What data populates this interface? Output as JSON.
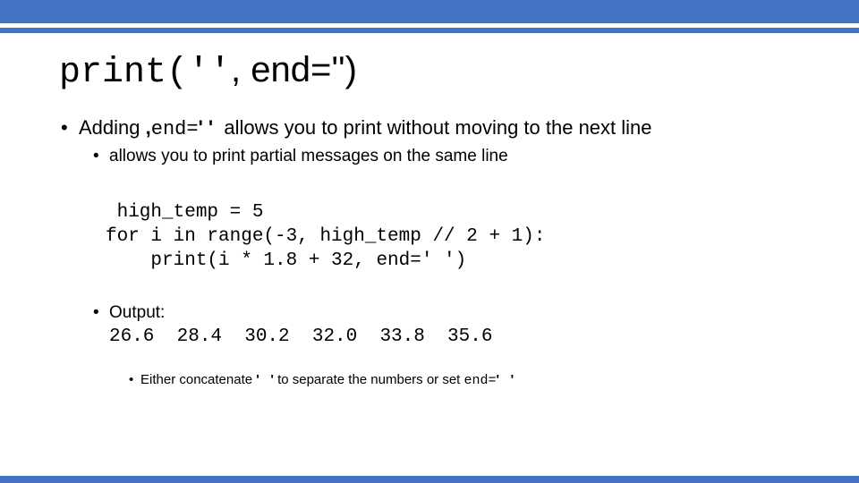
{
  "theme": {
    "accent_color": "#4472C4",
    "background_color": "#FFFFFF",
    "text_color": "#000000"
  },
  "title": {
    "part_mono_open": "print('",
    "part_mono_close": "'",
    "part_sans_tail": ", end='')"
  },
  "bullets": {
    "b1_dot": "•",
    "b1_text_a": "Adding ",
    "b1_code_comma": ",",
    "b1_code_end": "end=",
    "b1_code_quotes": "' '",
    "b1_text_b": "  allows you to print without moving to the next line",
    "b2_dot": "•",
    "b2_text": "allows you to print partial messages on the same line",
    "b3_dot": "•",
    "b3_text": "Output:",
    "b4_dot": "•",
    "b4_text_a": "Either concatenate ",
    "b4_quotes_1": "'   '",
    "b4_text_b": " to separate the numbers or set ",
    "b4_code_end": "end=",
    "b4_quotes_2": "'   '"
  },
  "code_block": {
    "lines": [
      " high_temp = 5",
      "for i in range(-3, high_temp // 2 + 1):",
      "    print(i * 1.8 + 32, end=' ')"
    ],
    "line_1": " high_temp = 5",
    "line_2": "for i in range(-3, high_temp // 2 + 1):",
    "line_3": "    print(i * 1.8 + 32, end=' ')"
  },
  "output": {
    "values_line": "26.6  28.4  30.2  32.0  33.8  35.6",
    "values": [
      "26.6",
      "28.4",
      "30.2",
      "32.0",
      "33.8",
      "35.6"
    ]
  }
}
